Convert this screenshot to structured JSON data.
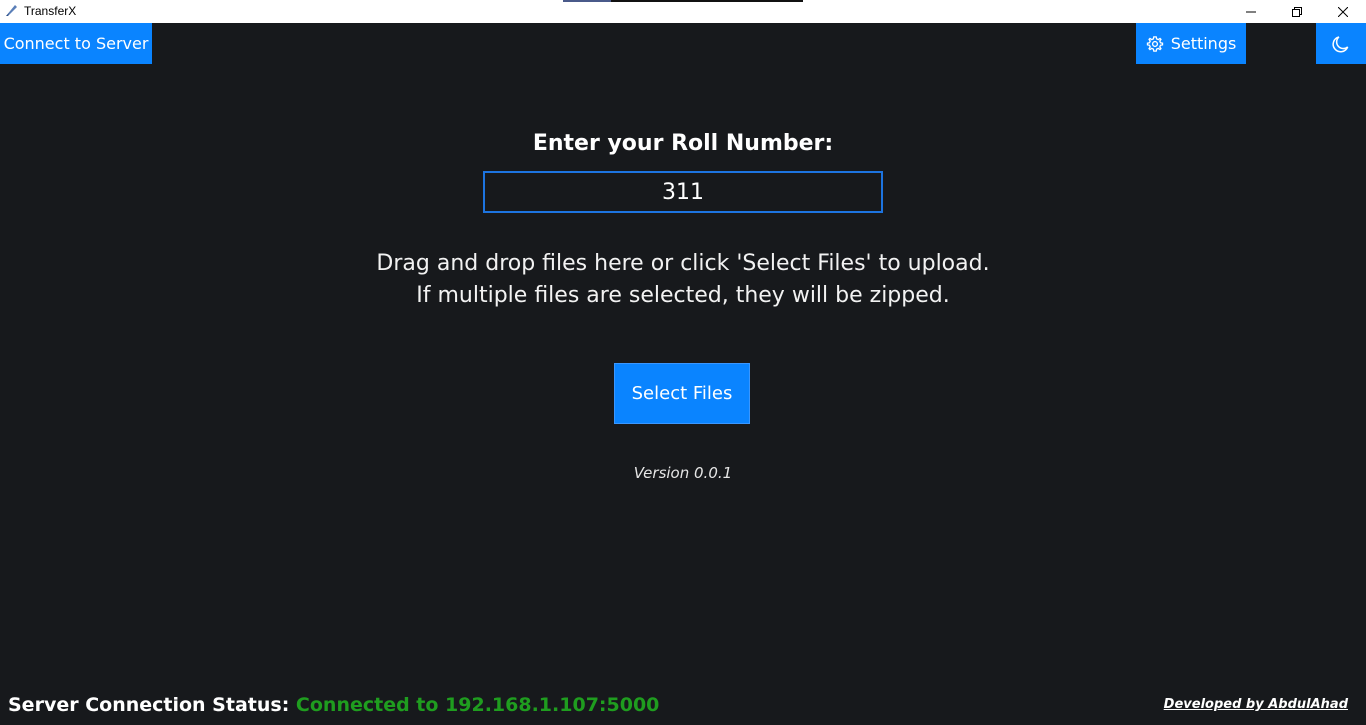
{
  "window": {
    "title": "TransferX",
    "icons": {
      "app": "transferx-app-icon",
      "minimize": "minimize-icon",
      "maximize": "restore-icon",
      "close": "close-icon"
    }
  },
  "toolbar": {
    "connect_label": "Connect to Server",
    "settings_label": "Settings",
    "settings_icon": "gear-icon",
    "theme_icon": "moon-icon"
  },
  "main": {
    "roll_label": "Enter your Roll Number:",
    "roll_value": "311",
    "drop_line_1": "Drag and drop files here or click 'Select Files' to upload.",
    "drop_line_2": "If multiple files are selected, they will be zipped.",
    "select_files_label": "Select Files",
    "version": "Version 0.0.1"
  },
  "footer": {
    "status_label": "Server Connection Status:",
    "status_value": "Connected to 192.168.1.107:5000",
    "developed_by": "Developed by AbdulAhad"
  },
  "colors": {
    "background": "#17191c",
    "accent": "#0a84ff",
    "status_ok": "#1f9d1f"
  }
}
